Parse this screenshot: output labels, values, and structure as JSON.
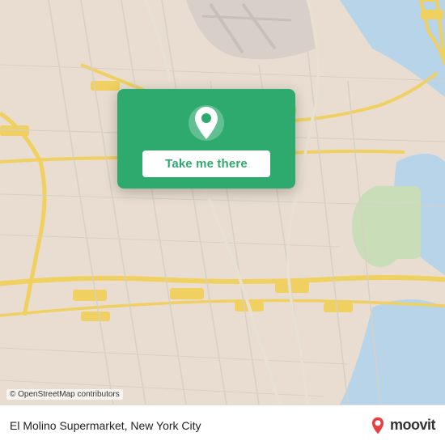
{
  "map": {
    "attribution": "© OpenStreetMap contributors",
    "popup": {
      "button_label": "Take me there"
    }
  },
  "footer": {
    "location_label": "El Molino Supermarket, New York City",
    "brand": "moovit"
  },
  "colors": {
    "map_bg": "#e8e0d8",
    "road_major": "#f5f0e8",
    "road_highway": "#f5c842",
    "road_stroke": "#d4c9b0",
    "green_accent": "#2eaa6e",
    "water": "#b0d4e8",
    "park": "#cde8c0"
  },
  "icons": {
    "pin": "location-pin-icon",
    "moovit_pin": "moovit-logo-pin-icon"
  }
}
